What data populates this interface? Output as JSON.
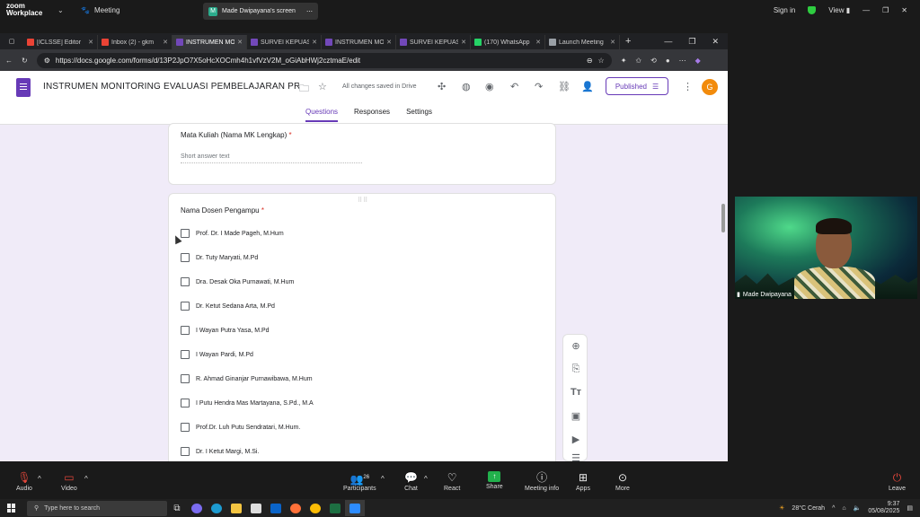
{
  "zoom": {
    "logo_line1": "zoom",
    "logo_line2": "Workplace",
    "meeting_label": "Meeting",
    "share_badge": "M",
    "share_label": "Made Dwipayana's screen",
    "sign_in": "Sign in",
    "view_label": "View"
  },
  "browser": {
    "tabs": [
      {
        "label": "[ICLSSE] Editor",
        "color": "#ea4335"
      },
      {
        "label": "Inbox (2) - gkm",
        "color": "#ea4335"
      },
      {
        "label": "INSTRUMEN MO",
        "color": "#7248b9"
      },
      {
        "label": "SURVEI KEPUAS",
        "color": "#7248b9"
      },
      {
        "label": "INSTRUMEN MO",
        "color": "#7248b9"
      },
      {
        "label": "SURVEI KEPUAS",
        "color": "#7248b9"
      },
      {
        "label": "(170) WhatsApp",
        "color": "#25d366"
      },
      {
        "label": "Launch Meeting",
        "color": "#9aa0a6"
      }
    ],
    "url": "https://docs.google.com/forms/d/13P2JpO7X5oHcXOCmh4h1vfVzV2M_oGiAbHWj2cztmaE/edit"
  },
  "forms": {
    "title": "INSTRUMEN MONITORING EVALUASI PEMBELAJARAN PRODI",
    "saved_status": "All changes saved in Drive",
    "published_label": "Published",
    "avatar_letter": "G",
    "tabs": [
      {
        "label": "Questions"
      },
      {
        "label": "Responses"
      },
      {
        "label": "Settings"
      }
    ]
  },
  "questions": {
    "q1": {
      "title": "Mata Kuliah (Nama MK Lengkap)",
      "required_mark": "*",
      "placeholder": "Short answer text"
    },
    "q2": {
      "title": "Nama Dosen Pengampu",
      "required_mark": "*",
      "options": [
        "Prof. Dr. I Made Pageh, M.Hum",
        "Dr. Tuty Maryati, M.Pd",
        "Dra. Desak Oka Purnawati, M.Hum",
        "Dr. Ketut Sedana Arta, M.Pd",
        "I Wayan Putra Yasa, M.Pd",
        "I Wayan Pardi, M.Pd",
        "R. Ahmad Ginanjar Purnawibawa, M.Hum",
        "I Putu Hendra Mas Martayana, S.Pd., M.A",
        "Prof.Dr. Luh Putu Sendratari, M.Hum.",
        "Dr. I Ketut Margi, M.Si."
      ]
    }
  },
  "video": {
    "participant_name": "Made Dwipayana"
  },
  "controls": {
    "audio": "Audio",
    "video": "Video",
    "participants": "Participants",
    "participant_count": "26",
    "chat": "Chat",
    "react": "React",
    "share": "Share",
    "meeting_info": "Meeting info",
    "apps": "Apps",
    "more": "More",
    "leave": "Leave"
  },
  "taskbar": {
    "search_placeholder": "Type here to search",
    "weather": "28°C  Cerah",
    "time": "9:37",
    "date": "05/08/2025"
  }
}
